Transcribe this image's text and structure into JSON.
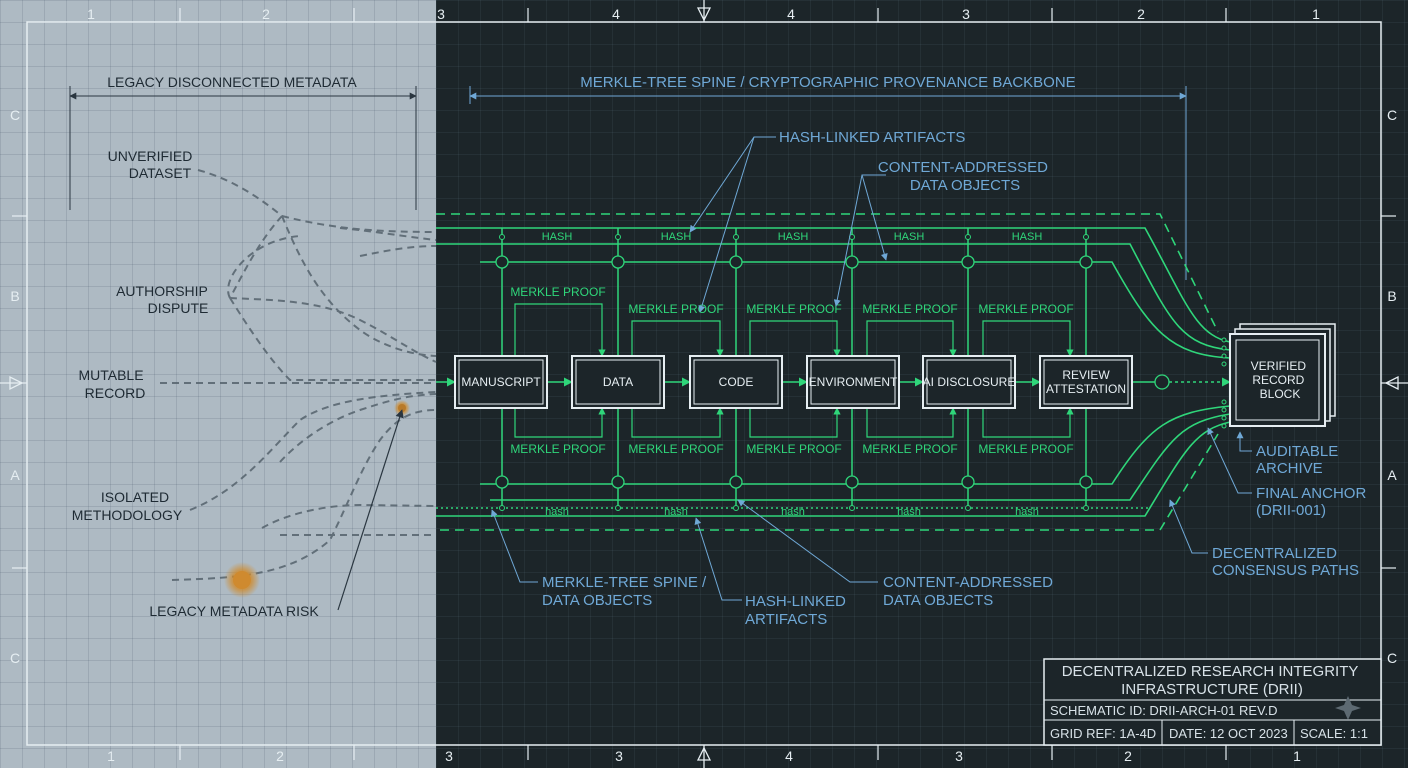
{
  "frame": {
    "top_numbers": [
      "1",
      "2",
      "3",
      "4",
      "4",
      "3",
      "2",
      "1"
    ],
    "bottom_numbers": [
      "1",
      "2",
      "3",
      "3",
      "4",
      "3",
      "2",
      "1"
    ],
    "left_letters": [
      "C",
      "B",
      "A",
      "C"
    ],
    "right_letters": [
      "C",
      "B",
      "A",
      "C"
    ]
  },
  "legacy": {
    "title": "LEGACY DISCONNECTED METADATA",
    "labels": [
      [
        "UNVERIFIED",
        "DATASET"
      ],
      [
        "AUTHORSHIP",
        "DISPUTE"
      ],
      [
        "MUTABLE",
        "RECORD"
      ],
      [
        "ISOLATED",
        "METHODOLOGY"
      ]
    ],
    "risk": "LEGACY METADATA RISK"
  },
  "spine": {
    "title": "MERKLE-TREE SPINE / CRYPTOGRAPHIC PROVENANCE BACKBONE",
    "hash_top": "HASH",
    "hash_bottom": "hash",
    "merkle_proof": "MERKLE PROOF",
    "nodes": [
      [
        "MANUSCRIPT"
      ],
      [
        "DATA"
      ],
      [
        "CODE"
      ],
      [
        "ENVIRONMENT"
      ],
      [
        "AI DISCLOSURE"
      ],
      [
        "REVIEW",
        "ATTESTATION"
      ]
    ],
    "record_block": [
      "VERIFIED",
      "RECORD",
      "BLOCK"
    ]
  },
  "callouts": {
    "hash_linked_top": "HASH-LINKED ARTIFACTS",
    "content_addressed_top": [
      "CONTENT-ADDRESSED",
      "DATA OBJECTS"
    ],
    "merkle_spine_bottom": [
      "MERKLE-TREE SPINE /",
      "DATA OBJECTS"
    ],
    "hash_linked_bottom": [
      "HASH-LINKED",
      "ARTIFACTS"
    ],
    "content_addressed_bottom": [
      "CONTENT-ADDRESSED",
      "DATA OBJECTS"
    ],
    "auditable_archive": [
      "AUDITABLE",
      "ARCHIVE"
    ],
    "final_anchor": [
      "FINAL ANCHOR",
      "(DRII-001)"
    ],
    "consensus": [
      "DECENTRALIZED",
      "CONSENSUS PATHS"
    ]
  },
  "title_block": {
    "title": [
      "DECENTRALIZED RESEARCH INTEGRITY",
      "INFRASTRUCTURE (DRII)"
    ],
    "schematic_id": "SCHEMATIC ID: DRII-ARCH-01 REV.D",
    "grid_ref": "GRID REF: 1A-4D",
    "date": "DATE: 12 OCT 2023",
    "scale": "SCALE: 1:1"
  },
  "colors": {
    "green": "#2fd67a",
    "blue": "#6fa8d6",
    "dark_text": "#1e2a33",
    "light_text": "#d8e2e8",
    "frame_line": "#e6eef2"
  }
}
